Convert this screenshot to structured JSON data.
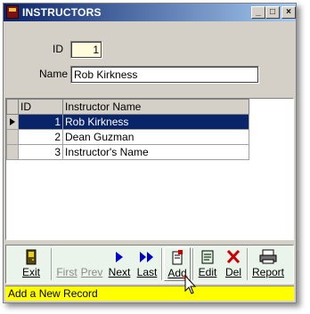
{
  "window": {
    "title": "INSTRUCTORS",
    "controls": {
      "minimize": "_",
      "maximize": "□",
      "close": "×"
    }
  },
  "form": {
    "id_label": "ID",
    "id_value": "1",
    "name_label": "Name",
    "name_value": "Rob Kirkness"
  },
  "grid": {
    "columns": [
      "ID",
      "Instructor Name"
    ],
    "rows": [
      {
        "id": "1",
        "name": "Rob Kirkness",
        "selected": true
      },
      {
        "id": "2",
        "name": "Dean Guzman",
        "selected": false
      },
      {
        "id": "3",
        "name": "Instructor's Name",
        "selected": false
      }
    ]
  },
  "toolbar": {
    "exit": "Exit",
    "first": "First",
    "prev": "Prev",
    "next": "Next",
    "last": "Last",
    "add": "Add",
    "edit": "Edit",
    "del": "Del",
    "report": "Report"
  },
  "status": {
    "text": "Add a New Record"
  },
  "colors": {
    "title_bar": "#0a246a",
    "selection": "#0a246a",
    "id_field_bg": "#fffbdc",
    "toolbar_bg": "#eaf4ea",
    "status_bg": "#ffff00",
    "nav_arrow": "#0000cc",
    "delete_x": "#cc0000"
  }
}
